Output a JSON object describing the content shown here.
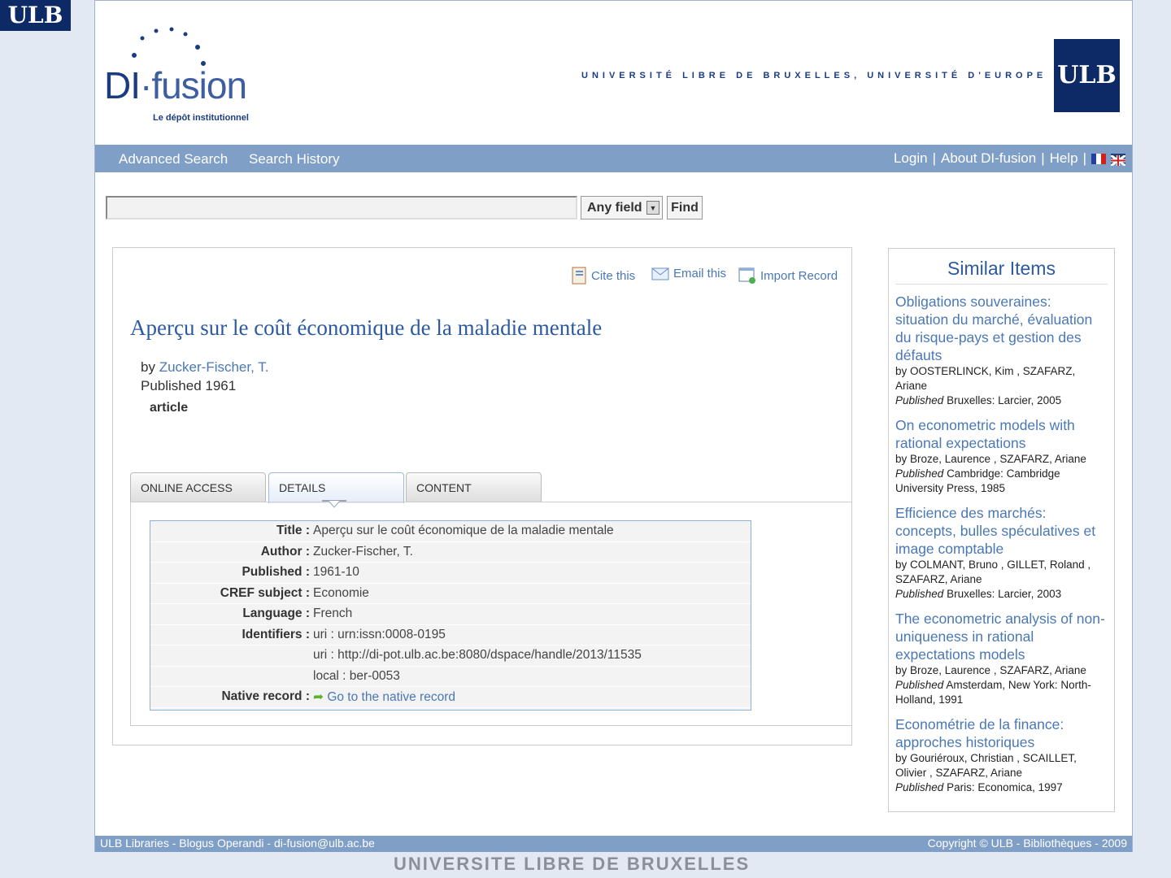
{
  "branding": {
    "corner_logo": "ULB",
    "logo_name_a": "DI",
    "logo_name_b": "·fusion",
    "logo_sub": "Le dépôt institutionnel",
    "tagline": "UNIVERSITÉ LIBRE DE BRUXELLES, UNIVERSITÉ D'EUROPE",
    "ulb_logo": "ULB"
  },
  "nav": {
    "advanced_search": "Advanced Search",
    "search_history": "Search History",
    "login": "Login",
    "about": "About DI-fusion",
    "help": "Help",
    "sep": "|"
  },
  "search": {
    "value": "",
    "field": "Any field",
    "find": "Find"
  },
  "toolbar": {
    "cite": "Cite this",
    "email": "Email this",
    "import": "Import Record"
  },
  "record": {
    "title": "Aperçu sur le coût économique de la maladie mentale",
    "by": "by",
    "author": "Zucker-Fischer, T.",
    "published": "Published 1961",
    "format": "article"
  },
  "tabs": [
    {
      "label": "ONLINE ACCESS"
    },
    {
      "label": "DETAILS"
    },
    {
      "label": "CONTENT"
    }
  ],
  "details": [
    {
      "k": "Title :",
      "v": "Aperçu sur le coût économique de la maladie mentale"
    },
    {
      "k": "Author :",
      "v": "Zucker-Fischer, T."
    },
    {
      "k": "Published :",
      "v": "1961-10"
    },
    {
      "k": "CREF subject :",
      "v": "Economie"
    },
    {
      "k": "Language :",
      "v": "French"
    },
    {
      "k": "Identifiers :",
      "v": "uri : urn:issn:0008-0195"
    },
    {
      "k": "",
      "v": "uri : http://di-pot.ulb.ac.be:8080/dspace/handle/2013/11535"
    },
    {
      "k": "",
      "v": "local : ber-0053"
    },
    {
      "k": "Native record :",
      "v": "Go to the native record"
    }
  ],
  "similar": {
    "heading": "Similar Items",
    "items": [
      {
        "title": "Obligations souveraines: situation du marché, évaluation du risque-pays et gestion des défauts",
        "authors": "by OOSTERLINCK, Kim , SZAFARZ, Ariane",
        "pub_label": "Published",
        "pub": "Bruxelles: Larcier, 2005"
      },
      {
        "title": "On econometric models with rational expectations",
        "authors": "by Broze, Laurence , SZAFARZ, Ariane",
        "pub_label": "Published",
        "pub": "Cambridge: Cambridge University Press, 1985"
      },
      {
        "title": "Efficience des marchés: concepts, bulles spéculatives et image comptable",
        "authors": "by COLMANT, Bruno , GILLET, Roland , SZAFARZ, Ariane",
        "pub_label": "Published",
        "pub": "Bruxelles: Larcier, 2003"
      },
      {
        "title": "The econometric analysis of non-uniqueness in rational expectations models",
        "authors": "by Broze, Laurence , SZAFARZ, Ariane",
        "pub_label": "Published",
        "pub": "Amsterdam, New York: North-Holland, 1991"
      },
      {
        "title": "Econométrie de la finance: approches historiques",
        "authors": "by Gouriéroux, Christian , SCAILLET, Olivier , SZAFARZ, Ariane",
        "pub_label": "Published",
        "pub": "Paris: Economica, 1997"
      }
    ]
  },
  "footer": {
    "left": "ULB Libraries - Blogus Operandi - di-fusion@ulb.ac.be",
    "right": "Copyright © ULB - Bibliothèques - 2009",
    "bottom": "UNIVERSITE LIBRE DE BRUXELLES"
  }
}
